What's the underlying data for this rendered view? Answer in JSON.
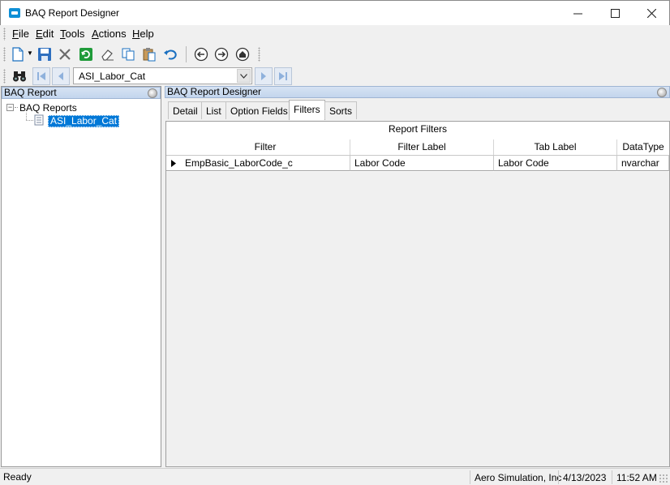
{
  "window": {
    "title": "BAQ Report Designer"
  },
  "menu": [
    "File",
    "Edit",
    "Tools",
    "Actions",
    "Help"
  ],
  "menu_underline": [
    "F",
    "E",
    "T",
    "A",
    "H"
  ],
  "report_selector": {
    "value": "ASI_Labor_Cat"
  },
  "left_pane": {
    "title": "BAQ Report",
    "tree": {
      "root": "BAQ Reports",
      "child": "ASI_Labor_Cat"
    }
  },
  "right_pane": {
    "title": "BAQ Report Designer",
    "tabs": [
      "Detail",
      "List",
      "Option Fields",
      "Filters",
      "Sorts"
    ],
    "active_tab": "Filters"
  },
  "grid": {
    "caption": "Report Filters",
    "columns": [
      "Filter",
      "Filter Label",
      "Tab Label",
      "DataType"
    ],
    "rows": [
      [
        "EmpBasic_LaborCode_c",
        "Labor Code",
        "Labor Code",
        "nvarchar"
      ]
    ]
  },
  "status": {
    "text": "Ready",
    "company": "Aero Simulation, Inc",
    "date": "4/13/2023",
    "time": "11:52 AM"
  },
  "icons": {
    "new": "new-document-icon",
    "save": "save-icon",
    "delete": "delete-icon",
    "refresh": "refresh-icon",
    "clear": "eraser-icon",
    "copy": "copy-icon",
    "paste": "paste-icon",
    "undo": "undo-icon",
    "back": "back-icon",
    "forward": "forward-icon",
    "home": "home-icon",
    "search": "binoculars-icon"
  },
  "colors": {
    "selection": "#0078d7",
    "accent": "#0e8fd6"
  }
}
